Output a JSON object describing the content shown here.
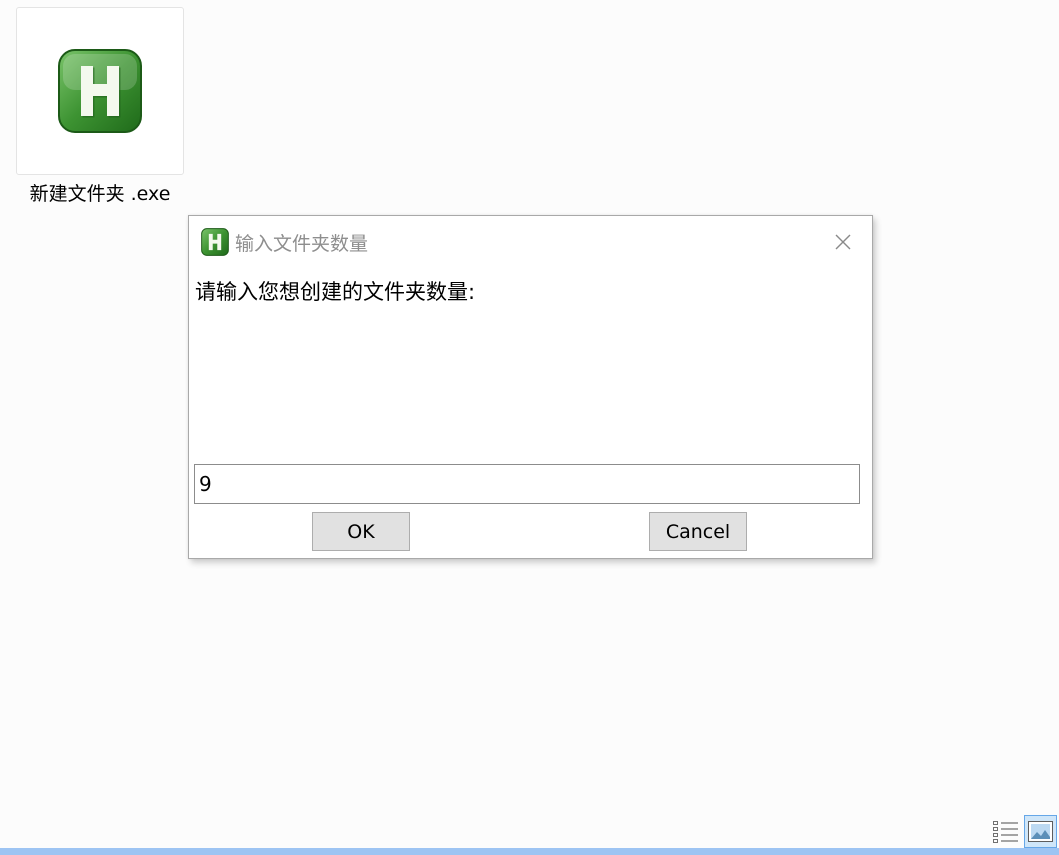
{
  "file": {
    "name": "新建文件夹 .exe",
    "icon": "autohotkey-h-icon"
  },
  "dialog": {
    "title": "输入文件夹数量",
    "prompt": "请输入您想创建的文件夹数量:",
    "input_value": "9",
    "ok_label": "OK",
    "cancel_label": "Cancel",
    "close_icon": "close-icon"
  },
  "view": {
    "details_icon": "details-view-icon",
    "thumbnails_icon": "large-icons-view-icon"
  },
  "colors": {
    "app_icon_green": "#3a8a2e",
    "selection_blue": "#9dc4f3",
    "button_face": "#e1e1e1"
  }
}
